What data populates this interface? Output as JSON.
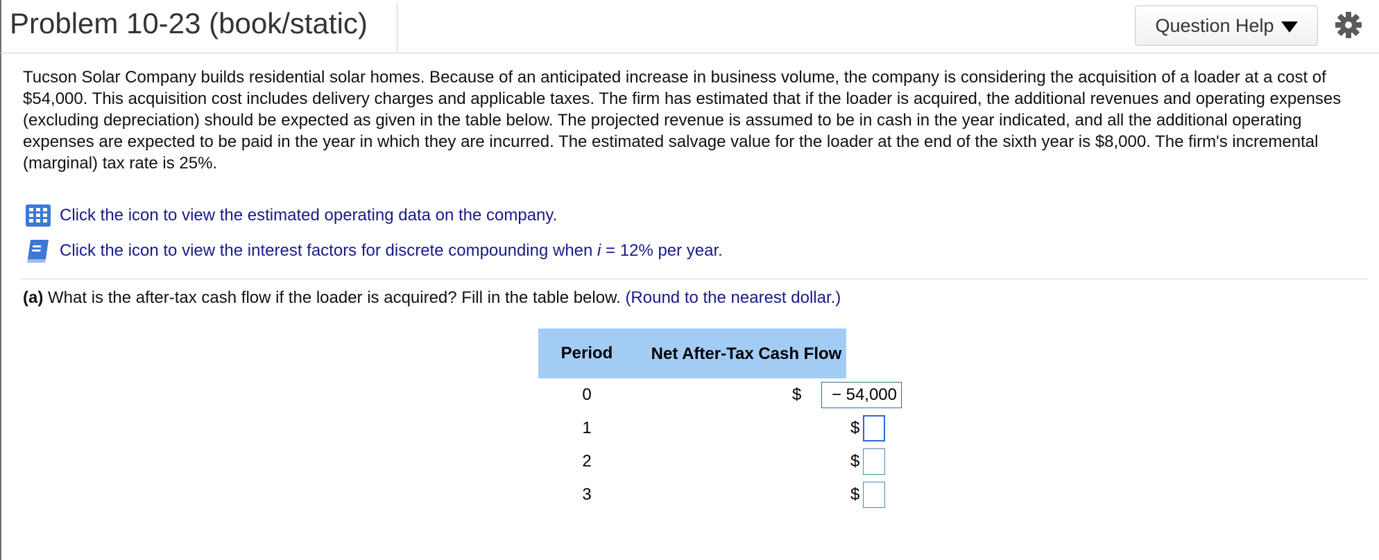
{
  "header": {
    "title": "Problem 10-23 (book/static)",
    "help_label": "Question Help"
  },
  "problem": {
    "text": "Tucson Solar Company builds residential solar homes. Because of an anticipated increase in business volume, the company is considering the acquisition of a loader at a cost of $54,000. This acquisition cost includes delivery charges and applicable taxes. The firm has estimated that if the loader is acquired, the additional revenues and operating expenses (excluding depreciation) should be expected as given in the table below. The projected revenue is assumed to be in cash in the year indicated, and all the additional operating expenses are expected to be paid in the year in which they are incurred. The estimated salvage value for the loader at the end of the sixth year is $8,000. The firm's incremental (marginal) tax rate is 25%."
  },
  "links": {
    "data_link": "Click the icon to view the estimated operating data on the company.",
    "factors_prefix": "Click the icon to view the interest factors for discrete compounding when ",
    "factors_var": "i",
    "factors_suffix": " = 12% per year."
  },
  "question": {
    "label": "(a)",
    "text": " What is the after-tax cash flow if the loader is acquired? Fill in the table below. ",
    "note": "(Round to the nearest dollar.)"
  },
  "table": {
    "headers": [
      "Period",
      "Net After-Tax Cash Flow"
    ],
    "currency_symbol": "$",
    "rows": [
      {
        "period": "0",
        "value": "− 54,000"
      },
      {
        "period": "1",
        "value": ""
      },
      {
        "period": "2",
        "value": ""
      },
      {
        "period": "3",
        "value": ""
      }
    ]
  },
  "colors": {
    "link_blue": "#1a1a8a",
    "table_header_bg": "#a3ccf5",
    "calc_icon_blue": "#3b78d8",
    "book_icon_blue": "#3b78d8"
  },
  "icons": {
    "calculator": "grid-table-icon",
    "book": "book-icon",
    "gear": "gear-icon",
    "caret": "caret-down-icon"
  }
}
